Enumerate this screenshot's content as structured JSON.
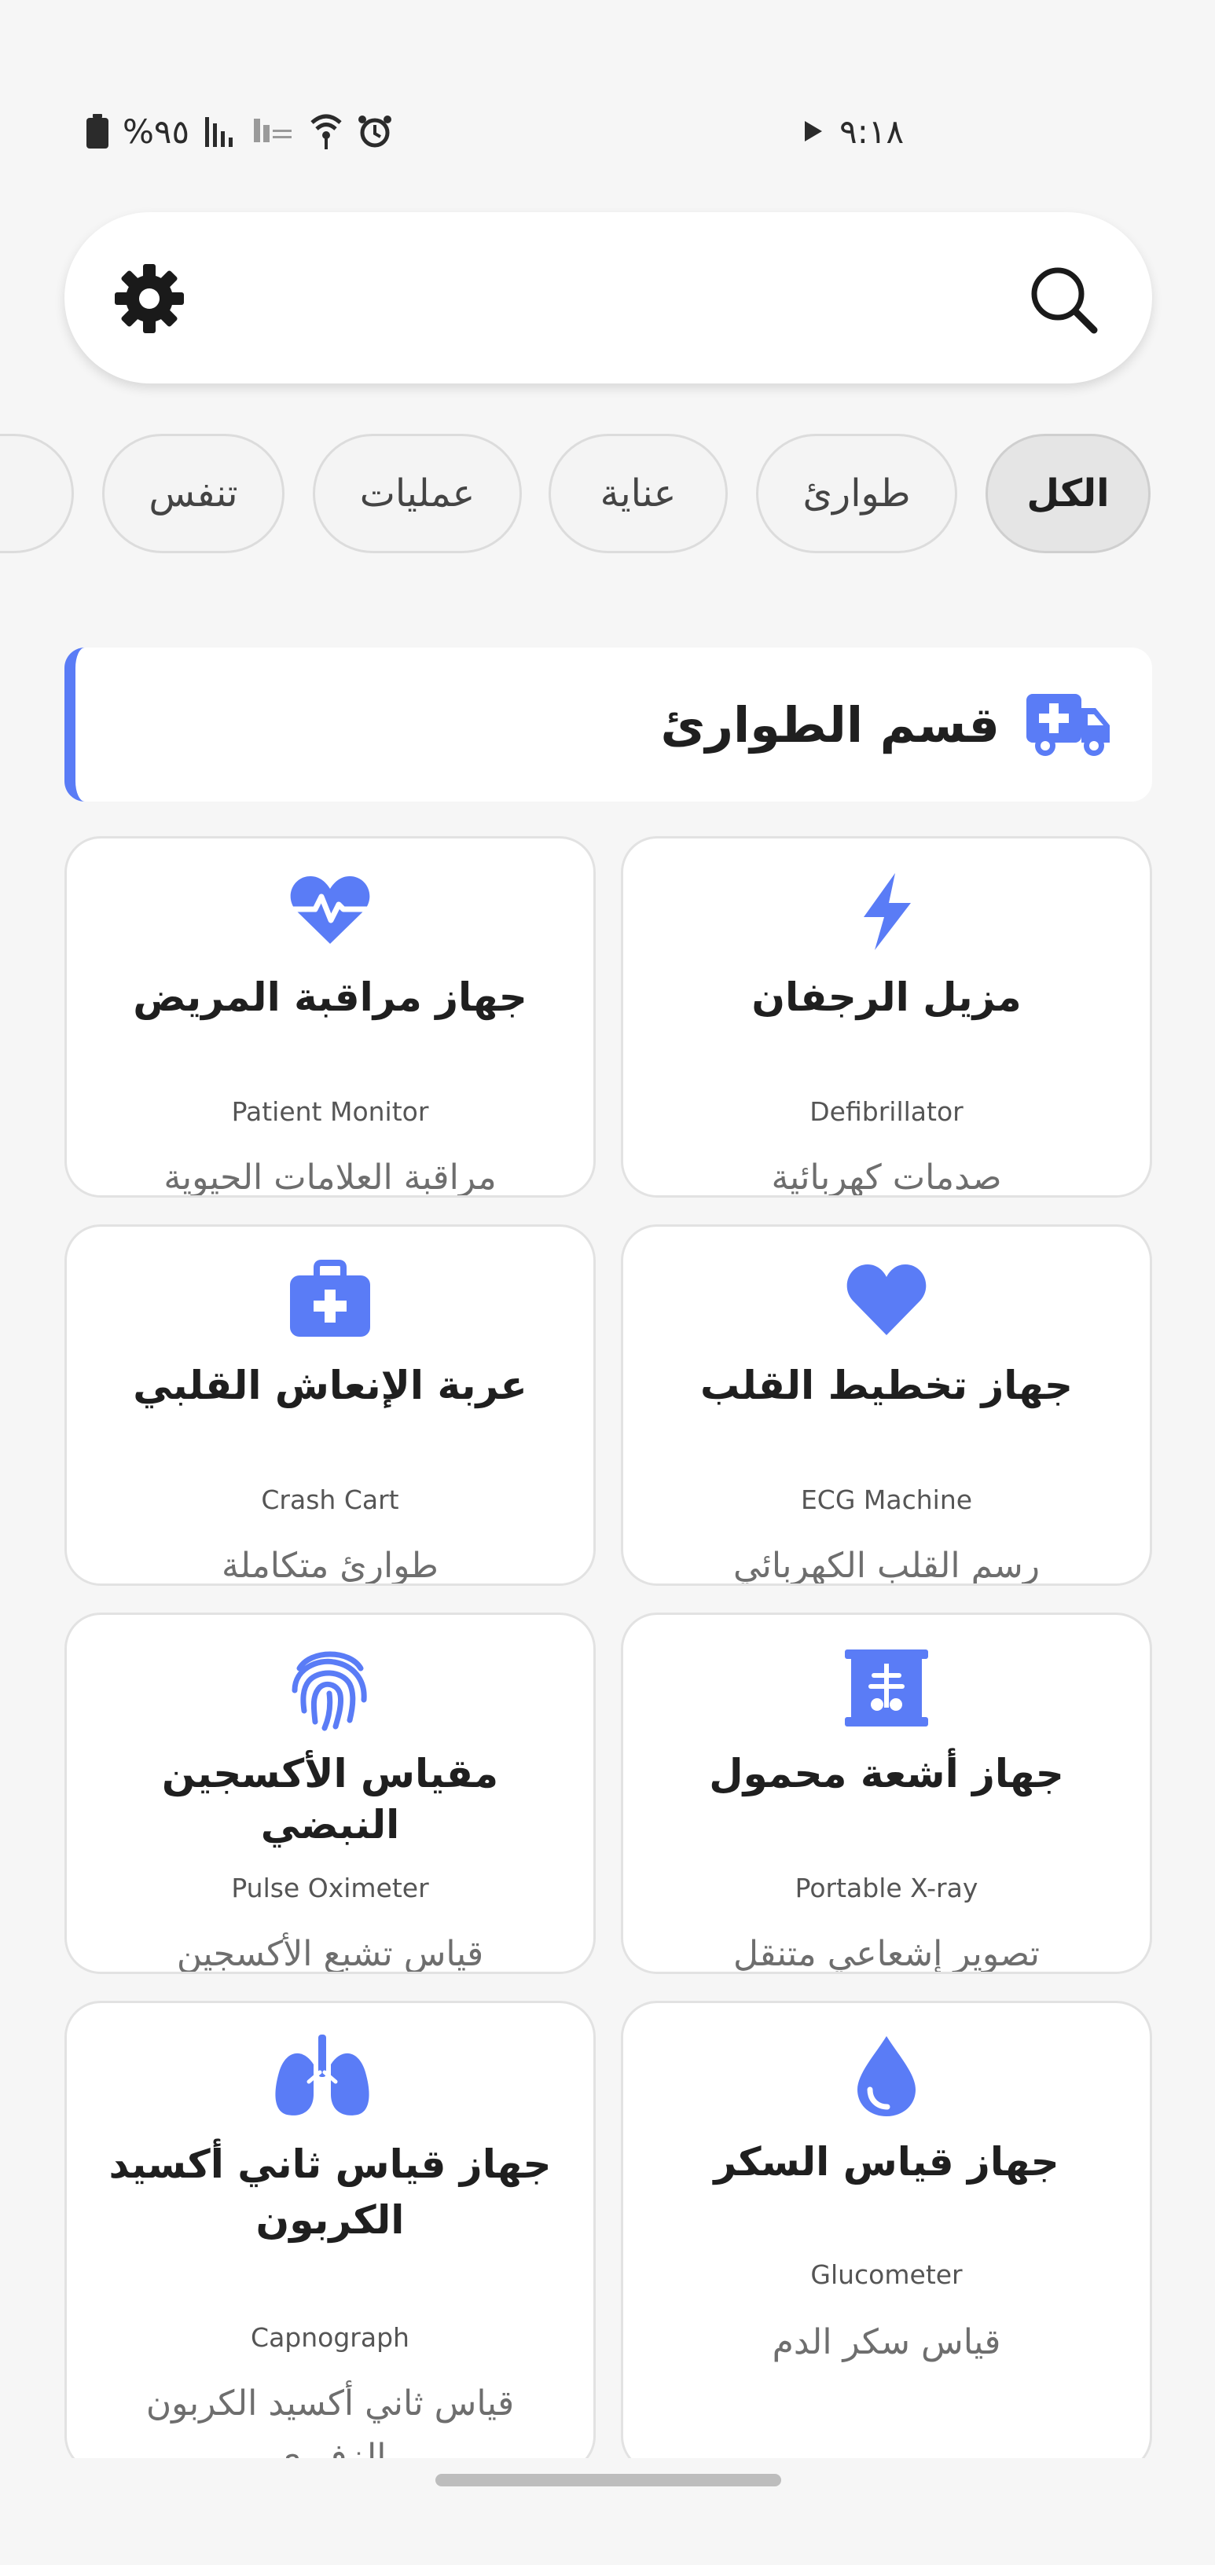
{
  "status": {
    "time": "٩:١٨",
    "battery": "%٩٥"
  },
  "search": {},
  "filters": [
    {
      "label": "الكل",
      "active": true
    },
    {
      "label": "طوارئ",
      "active": false
    },
    {
      "label": "عناية",
      "active": false
    },
    {
      "label": "عمليات",
      "active": false
    },
    {
      "label": "تنفس",
      "active": false
    }
  ],
  "section": {
    "title": "قسم الطوارئ",
    "icon": "ambulance-icon"
  },
  "devices": [
    {
      "ar": "مزيل الرجفان",
      "en": "Defibrillator",
      "desc": "صدمات كهربائية",
      "icon": "bolt-icon"
    },
    {
      "ar": "جهاز مراقبة المريض",
      "en": "Patient Monitor",
      "desc": "مراقبة العلامات الحيوية",
      "icon": "heart-pulse-icon"
    },
    {
      "ar": "جهاز تخطيط القلب",
      "en": "ECG Machine",
      "desc": "رسم القلب الكهربائي",
      "icon": "heart-icon"
    },
    {
      "ar": "عربة الإنعاش القلبي",
      "en": "Crash Cart",
      "desc": "طوارئ متكاملة",
      "icon": "medkit-icon"
    },
    {
      "ar": "جهاز أشعة محمول",
      "en": "Portable X-ray",
      "desc": "تصوير إشعاعي متنقل",
      "icon": "xray-icon"
    },
    {
      "ar": "مقياس الأكسجين النبضي",
      "en": "Pulse Oximeter",
      "desc": "قياس تشبع الأكسجين",
      "icon": "fingerprint-icon"
    },
    {
      "ar": "جهاز قياس السكر",
      "en": "Glucometer",
      "desc": "قياس سكر الدم",
      "icon": "droplet-icon"
    },
    {
      "ar": "جهاز قياس ثاني أكسيد الكربون",
      "en": "Capnograph",
      "desc": "قياس ثاني أكسيد الكربون الزفيري",
      "icon": "lungs-icon"
    }
  ],
  "colors": {
    "accent": "#5a7cf6",
    "background": "#f6f6f6",
    "card": "#ffffff"
  }
}
